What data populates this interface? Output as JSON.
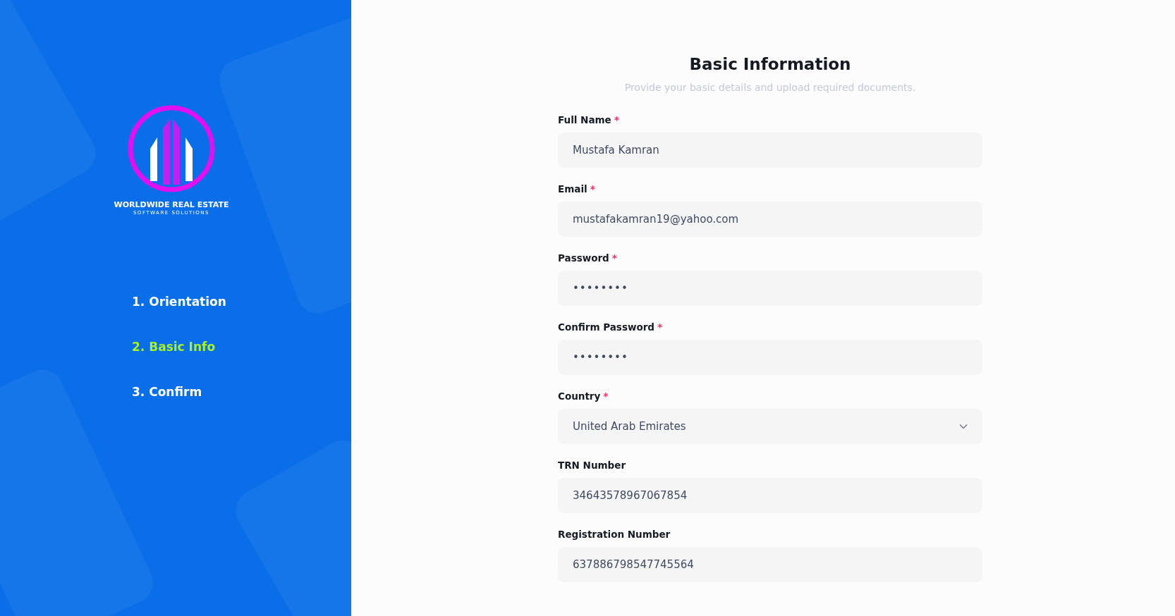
{
  "brand": {
    "name": "WORLDWIDE REAL ESTATE",
    "tagline": "SOFTWARE SOLUTIONS"
  },
  "steps": [
    {
      "label": "1. Orientation",
      "selected": false
    },
    {
      "label": "2. Basic Info",
      "selected": true
    },
    {
      "label": "3. Confirm",
      "selected": false
    }
  ],
  "form": {
    "title": "Basic Information",
    "subtitle": "Provide your basic details and upload required documents.",
    "fields": [
      {
        "kind": "text",
        "label": "Full Name",
        "required_mark": "*",
        "value": "Mustafa Kamran"
      },
      {
        "kind": "text",
        "label": "Email",
        "required_mark": "*",
        "value": "mustafakamran19@yahoo.com"
      },
      {
        "kind": "password",
        "label": "Password",
        "required_mark": "*",
        "value": "••••••••"
      },
      {
        "kind": "password",
        "label": "Confirm Password",
        "required_mark": "*",
        "value": "••••••••"
      },
      {
        "kind": "select",
        "label": "Country",
        "required_mark": "*",
        "value": "United Arab Emirates"
      },
      {
        "kind": "text",
        "label": "TRN Number",
        "value": "34643578967067854"
      },
      {
        "kind": "text",
        "label": "Registration Number",
        "value": "637886798547745564"
      }
    ]
  }
}
